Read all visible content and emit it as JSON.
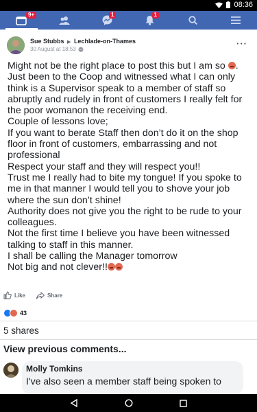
{
  "status_bar": {
    "time": "08:36"
  },
  "nav": {
    "items": [
      {
        "name": "home",
        "badge": "9+"
      },
      {
        "name": "friends",
        "badge": ""
      },
      {
        "name": "messenger",
        "badge": "1"
      },
      {
        "name": "notifications",
        "badge": "1"
      },
      {
        "name": "search",
        "badge": ""
      },
      {
        "name": "menu",
        "badge": ""
      }
    ]
  },
  "post": {
    "author": "Sue Stubbs",
    "group": "Lechlade-on-Thames",
    "timestamp": "30 August at 18:53",
    "lines": [
      "Might not be the right place to post this but I am so",
      "Just been to the Coop and witnessed what I can only",
      "think is a Supervisor speak to a member of staff so",
      "abruptly and rudely in front of customers I really felt for",
      "the poor womanon the receiving end.",
      "Couple of lessons love;",
      "If you want to berate Staff then don’t do it on the shop",
      "floor in front of customers, embarrassing and not",
      "professional",
      "Respect your staff and they will respect you!!",
      "Trust me I really had to bite my tongue! If you spoke to",
      "me in that manner I would tell you to shove your job",
      "where the sun don’t shine!",
      "Authority does not give you the right to be rude to your",
      "colleagues.",
      "Not the first time I believe you have been witnessed",
      "talking to staff in this manner.",
      "I shall be calling the Manager tomorrow",
      "Not big and not clever!!"
    ],
    "like_label": "Like",
    "share_label": "Share",
    "reaction_count": "43",
    "shares_text": "5 shares",
    "view_previous": "View previous comments..."
  },
  "comment": {
    "author": "Molly Tomkins",
    "text": "I've also seen a member staff being spoken to"
  },
  "colors": {
    "fb_blue": "#4267b2",
    "badge_red": "#e41e3f",
    "like_blue": "#1877f2",
    "angry_orange": "#e2694f"
  }
}
